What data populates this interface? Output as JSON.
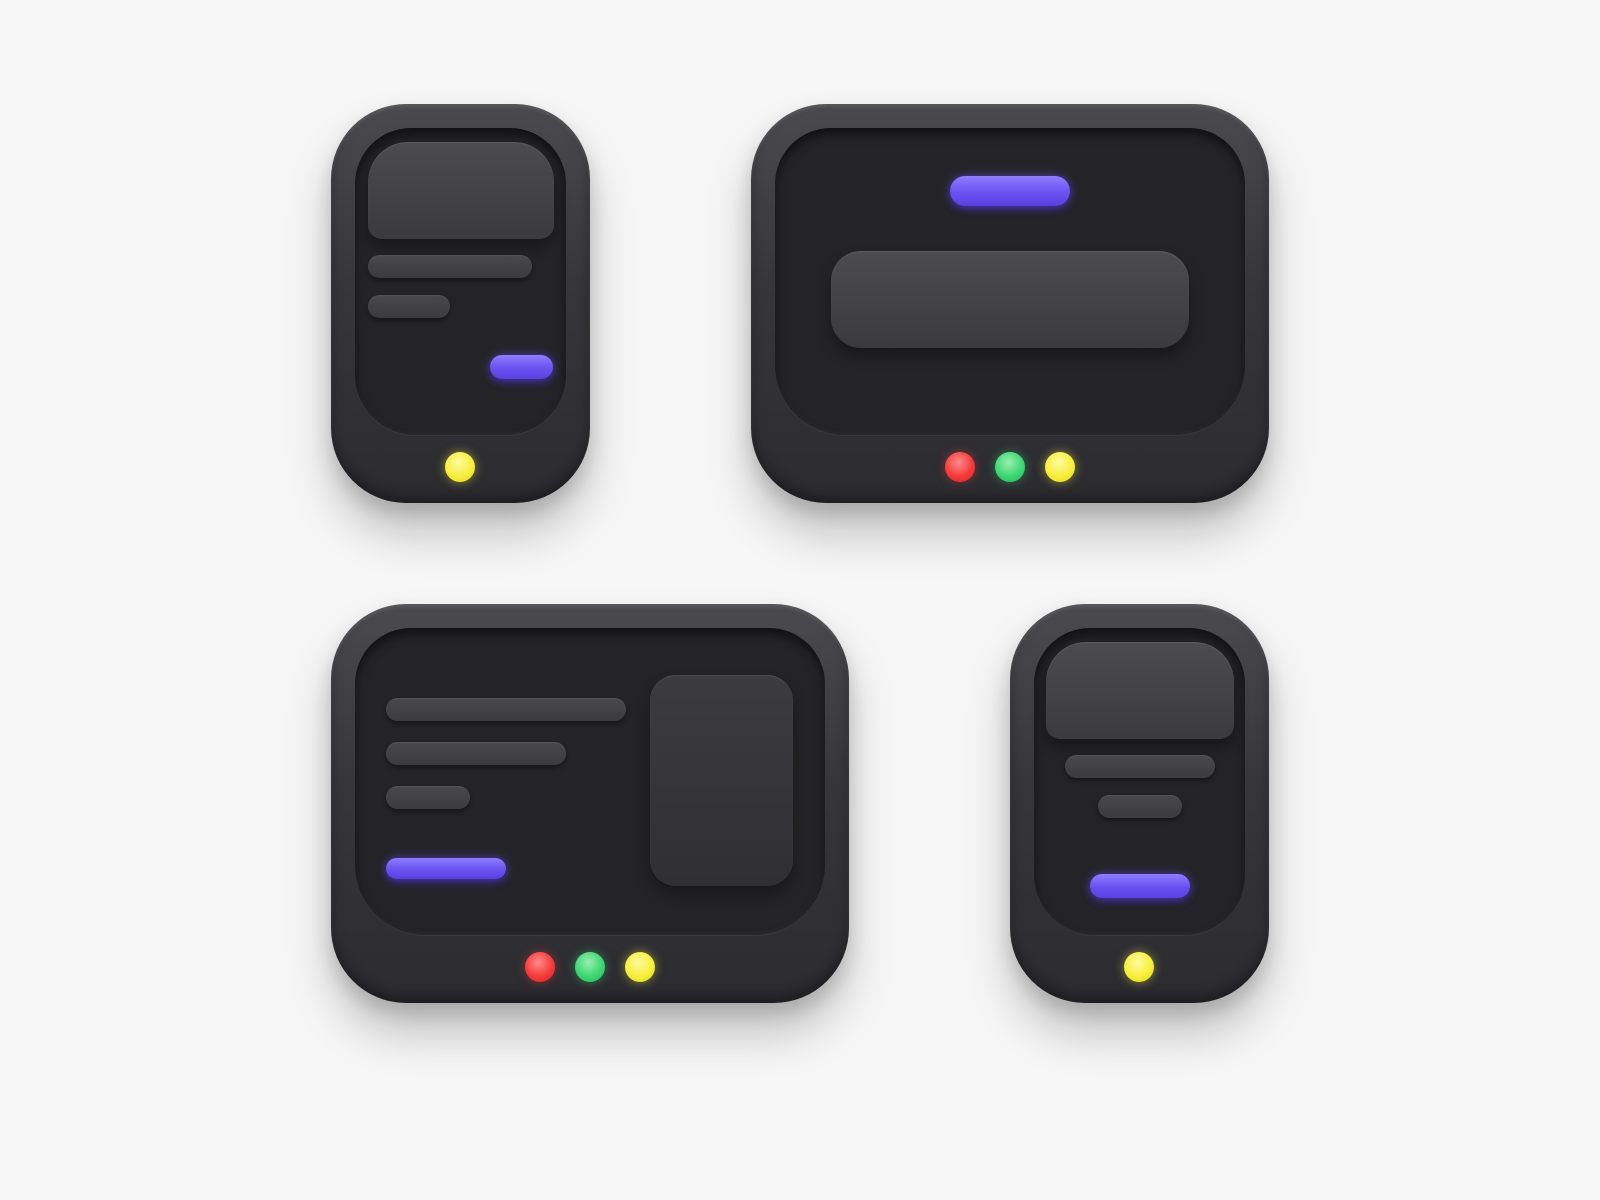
{
  "colors": {
    "background": "#f6f6f6",
    "device_body": "#36363b",
    "screen": "#242428",
    "accent_pill": "#6a52f0",
    "led_red": "#f53b3b",
    "led_green": "#3dd672",
    "led_yellow": "#f7ef3c"
  },
  "devices": [
    {
      "name": "device-portrait-top-left",
      "leds": [
        "yellow"
      ]
    },
    {
      "name": "device-landscape-top-right",
      "leds": [
        "red",
        "green",
        "yellow"
      ]
    },
    {
      "name": "device-landscape-bottom-left",
      "leds": [
        "red",
        "green",
        "yellow"
      ]
    },
    {
      "name": "device-portrait-bottom-right",
      "leds": [
        "yellow"
      ]
    }
  ]
}
